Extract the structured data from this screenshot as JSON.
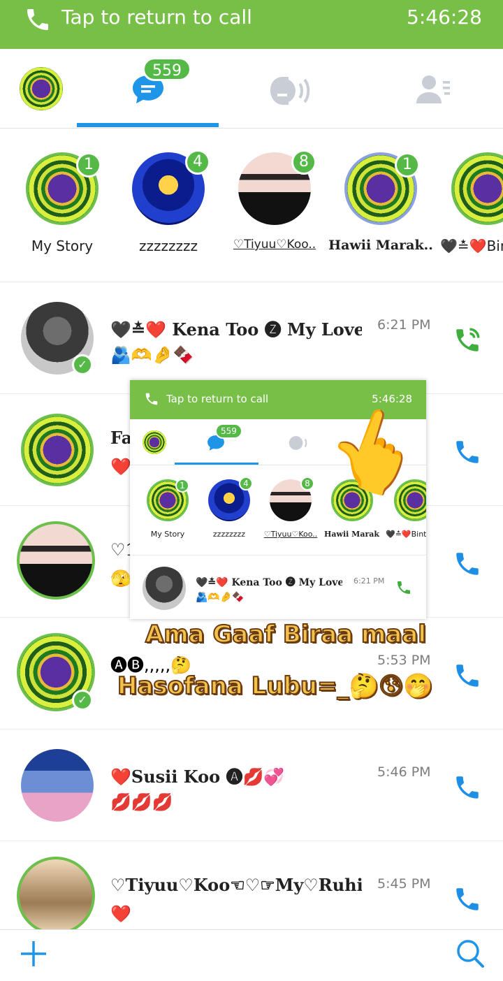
{
  "call_banner": {
    "label": "Tap to return to call",
    "time": "5:46:28"
  },
  "tabs": {
    "chats_badge": "559"
  },
  "stories": [
    {
      "label": "My Story",
      "count": "1"
    },
    {
      "label": "zzzzzzzz",
      "count": "4"
    },
    {
      "label": "♡Tiyuu♡Koo..",
      "count": "8"
    },
    {
      "label": "Hawii Marak..",
      "count": "1"
    },
    {
      "label": "🖤≛❤️Binti",
      "count": ""
    }
  ],
  "chats": [
    {
      "name": "🖤≛❤️ Kena Too 🅩 My Love...",
      "preview": "🫂🫶🤌🍫",
      "time": "6:21 PM",
      "online": true
    },
    {
      "name": "Fa",
      "preview": "❤️",
      "time": "",
      "online": false
    },
    {
      "name": "♡1",
      "preview": "🫣",
      "time": "",
      "online": false
    },
    {
      "name": "",
      "preview": "🅐🅑,,,,,🤔",
      "time": "5:53 PM",
      "online": true
    },
    {
      "name": "❤️Susii Koo 🅐💋💞",
      "preview": "💋💋💋",
      "time": "5:46 PM",
      "online": false
    },
    {
      "name": "♡Tiyuu♡Koo☜♡☞My♡Ruhi...",
      "preview": "❤️",
      "time": "5:45 PM",
      "online": false
    }
  ],
  "overlay": {
    "call_label": "Tap to return to call",
    "call_time": "5:46:28",
    "badge": "559",
    "stories": [
      "My Story",
      "zzzzzzzz",
      "♡Tiyuu♡Koo..",
      "Hawii Marak..",
      "🖤≛❤️Binti"
    ],
    "story_counts": [
      "1",
      "4",
      "8"
    ],
    "chat": {
      "name": "🖤≛❤️ Kena Too 🅩 My Love...",
      "preview": "🫂🫶🤌🍫",
      "time": "6:21 PM"
    }
  },
  "sticker_text": {
    "line1": "Ama Gaaf Biraa maal",
    "line2": "Hasofana Lubu=_🤔😰🤭"
  },
  "icons": {
    "phone": "phone-icon",
    "messages": "chat-bubble-icon",
    "calls": "call-audio-icon",
    "contacts": "contacts-icon",
    "add": "plus-icon",
    "search": "search-icon"
  },
  "colors": {
    "accent_green": "#78bf48",
    "badge_green": "#55b947",
    "tab_blue": "#1f95e8",
    "call_icon_blue": "#1f8fe6",
    "active_call_green": "#3fae3f"
  }
}
